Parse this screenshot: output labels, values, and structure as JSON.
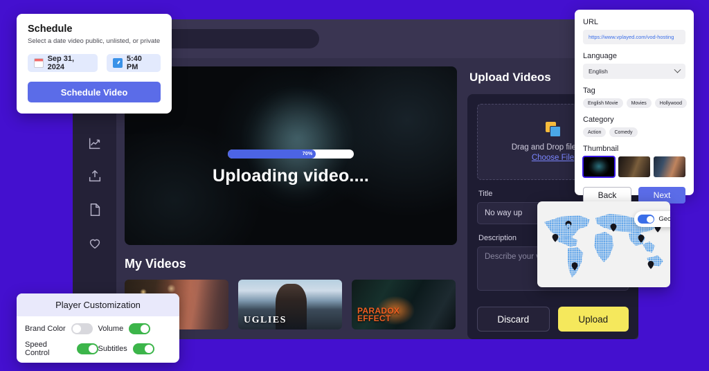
{
  "background_color": "#4410cf",
  "app": {
    "search_placeholder": "",
    "sidebar_icons": [
      "analytics-icon",
      "upload-icon",
      "document-icon",
      "heart-icon"
    ]
  },
  "player": {
    "progress_percent": 70,
    "progress_label": "70%",
    "status_text": "Uploading video...."
  },
  "my_videos": {
    "title": "My Videos",
    "items": [
      {
        "name": "video-thumb-1",
        "logo": ""
      },
      {
        "name": "video-thumb-2",
        "logo": "UGLIES"
      },
      {
        "name": "video-thumb-3",
        "logo": "PARADOX\nEFFECT"
      }
    ],
    "item2_logo": "UGLIES",
    "item3_logo_line1": "PARADOX",
    "item3_logo_line2": "EFFECT"
  },
  "upload": {
    "title": "Upload Videos",
    "dropzone_text": "Drag and Drop file here",
    "choose_file_label": "Choose File",
    "title_label": "Title",
    "title_value": "No way up",
    "description_label": "Description",
    "description_placeholder": "Describe your video...",
    "discard_label": "Discard",
    "upload_label": "Upload",
    "upload_button_color": "#f5e85c"
  },
  "schedule": {
    "title": "Schedule",
    "subtitle": "Select a date video public, unlisted, or private",
    "date_value": "Sep 31, 2024",
    "time_value": "5:40 PM",
    "button_label": "Schedule Video",
    "button_color": "#5b6ce8"
  },
  "details": {
    "url_label": "URL",
    "url_value": "https://www.vplayed.com/vod-hosting",
    "language_label": "Language",
    "language_value": "English",
    "tag_label": "Tag",
    "tags": [
      "English Movie",
      "Movies",
      "Hollywood"
    ],
    "category_label": "Category",
    "categories": [
      "Action",
      "Comedy"
    ],
    "thumbnail_label": "Thumbnail",
    "thumbnails": [
      "thumbnail-1-selected",
      "thumbnail-2",
      "thumbnail-3"
    ],
    "back_label": "Back",
    "next_label": "Next",
    "next_color": "#5b6ce8"
  },
  "geo": {
    "toggle_label": "Geo - Block",
    "toggle_on": true,
    "toggle_color": "#3a6ee8",
    "markers": [
      {
        "x": 45,
        "y": 30
      },
      {
        "x": 25,
        "y": 43
      },
      {
        "x": 56,
        "y": 28
      },
      {
        "x": 78,
        "y": 37
      },
      {
        "x": 90,
        "y": 27
      },
      {
        "x": 55,
        "y": 75
      },
      {
        "x": 85,
        "y": 72
      }
    ]
  },
  "player_customization": {
    "title": "Player Customization",
    "settings": [
      {
        "label": "Brand Color",
        "on": false
      },
      {
        "label": "Volume",
        "on": true
      },
      {
        "label": "Speed Control",
        "on": true
      },
      {
        "label": "Subtitles",
        "on": true
      }
    ],
    "on_color": "#3cb54a",
    "off_color": "#d8d8dd"
  }
}
